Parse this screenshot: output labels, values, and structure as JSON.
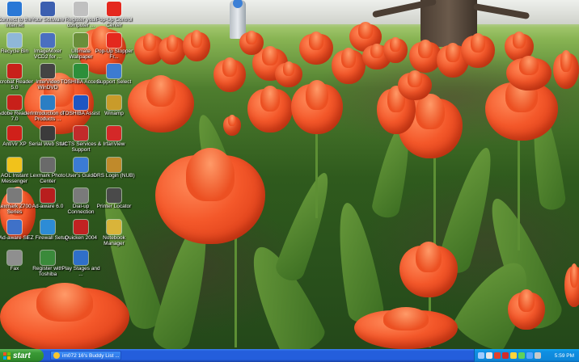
{
  "desktop": {
    "icons": [
      {
        "label": "Connect to the Internet",
        "icon": "globe-icon",
        "color": "#2a78d6"
      },
      {
        "label": "Your Software",
        "icon": "media-icon",
        "color": "#3c5fb0"
      },
      {
        "label": "Register your computer ...",
        "icon": "register-icon",
        "color": "#c0c0c0"
      },
      {
        "label": "Pop-Up Control Center",
        "icon": "popup-icon",
        "color": "#e4281e"
      },
      {
        "label": "Recycle Bin",
        "icon": "recycle-bin-icon",
        "color": "#8fb7d8"
      },
      {
        "label": "ImageMixer VCD2 for ...",
        "icon": "imagemixer-icon",
        "color": "#4a6fc0"
      },
      {
        "label": "Ultimate Wallpaper",
        "icon": "wallpaper-icon",
        "color": "#6a8f3a"
      },
      {
        "label": "Pop-Up Stopper Fr...",
        "icon": "stopper-icon",
        "color": "#e4281e"
      },
      {
        "label": "Acrobat Reader 5.0",
        "icon": "acrobat-icon",
        "color": "#c8201a"
      },
      {
        "label": "InterVideo WinDVD",
        "icon": "windvd-icon",
        "color": "#444444"
      },
      {
        "label": "TOSHIBA Access",
        "icon": "toshiba-access-icon",
        "color": "#2c8f3a"
      },
      {
        "label": "Support Select",
        "icon": "support-icon",
        "color": "#3d7bd1"
      },
      {
        "label": "Adobe Reader 7.0",
        "icon": "adobe-reader-icon",
        "color": "#c8201a"
      },
      {
        "label": "Introduction of Products ...",
        "icon": "intro-icon",
        "color": "#2b7ec4"
      },
      {
        "label": "TOSHIBA Assist",
        "icon": "toshiba-assist-icon",
        "color": "#1e56c2"
      },
      {
        "label": "Winamp",
        "icon": "winamp-icon",
        "color": "#c99b2a"
      },
      {
        "label": "AntiVir XP",
        "icon": "antivir-icon",
        "color": "#d0201a"
      },
      {
        "label": "Serial Web Start",
        "icon": "web-icon",
        "color": "#3b3b3b"
      },
      {
        "label": "UCTS Services & Support",
        "icon": "services-icon",
        "color": "#c22b2b"
      },
      {
        "label": "IrfanView",
        "icon": "irfanview-icon",
        "color": "#d42828"
      },
      {
        "label": "AOL Instant Messenger",
        "icon": "aim-icon",
        "color": "#f1c21b"
      },
      {
        "label": "Lexmark Photo Center",
        "icon": "lexmark-icon",
        "color": "#6a6a6a"
      },
      {
        "label": "User's Guide",
        "icon": "guide-icon",
        "color": "#3b7bd4"
      },
      {
        "label": "DRS Login (NUB)",
        "icon": "drs-icon",
        "color": "#c08a2b"
      },
      {
        "label": "Lexmark Z700 Series",
        "icon": "printer-icon",
        "color": "#7a7a7a"
      },
      {
        "label": "Ad-aware 6.0",
        "icon": "adaware-icon",
        "color": "#b81e1e"
      },
      {
        "label": "Dial-up Connection",
        "icon": "dialup-icon",
        "color": "#7a7a7a"
      },
      {
        "label": "Printer Locator",
        "icon": "printer-locator-icon",
        "color": "#4a4a4a"
      },
      {
        "label": "Ad-aware SE",
        "icon": "adaware-se-icon",
        "color": "#3f71c8"
      },
      {
        "label": "EZ Firewall Setup",
        "icon": "firewall-icon",
        "color": "#2d8cd6"
      },
      {
        "label": "Quicken 2004",
        "icon": "quicken-icon",
        "color": "#c12222"
      },
      {
        "label": "Notebook Manager",
        "icon": "notebook-icon",
        "color": "#d9b43a"
      },
      {
        "label": "Fax",
        "icon": "fax-icon",
        "color": "#8f8f8f"
      },
      {
        "label": "Register with Toshiba",
        "icon": "register-toshiba-icon",
        "color": "#3a8a3a"
      },
      {
        "label": "Play Stages and ...",
        "icon": "play-icon",
        "color": "#2f6fc9"
      }
    ]
  },
  "taskbar": {
    "start_label": "start",
    "tasks": [
      {
        "label": "im072 16's Buddy List ...",
        "icon": "aim-icon"
      }
    ],
    "tray_icons": [
      "network-icon",
      "volume-icon",
      "shield-icon",
      "antivirus-icon",
      "update-icon",
      "battery-icon",
      "msn-icon",
      "display-icon"
    ],
    "clock": "5:59 PM"
  }
}
